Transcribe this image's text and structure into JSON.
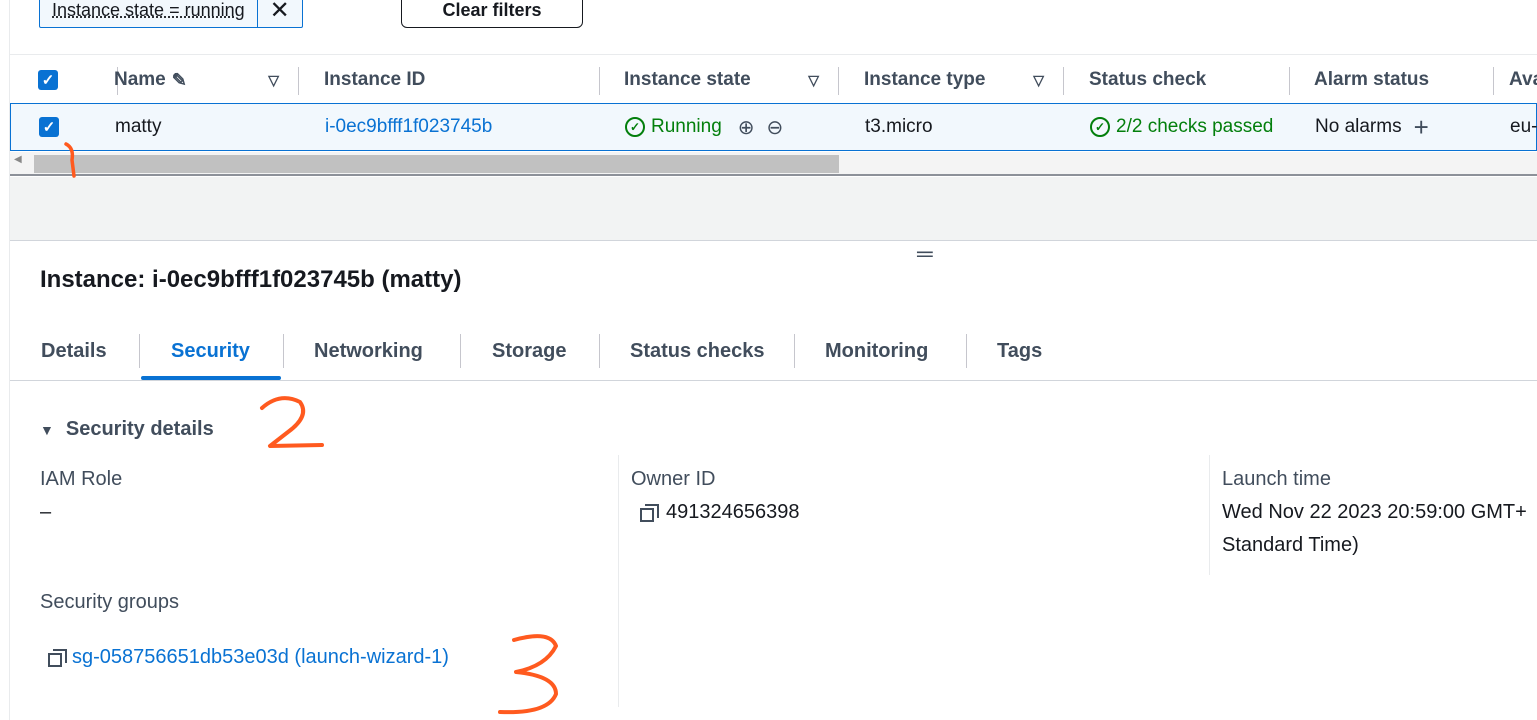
{
  "filters": {
    "token_text": "Instance state = running",
    "remove_icon": "close-icon",
    "clear_label": "Clear filters"
  },
  "table": {
    "headers": [
      "Name",
      "Instance ID",
      "Instance state",
      "Instance type",
      "Status check",
      "Alarm status",
      "Ava"
    ],
    "row": {
      "name": "matty",
      "instance_id": "i-0ec9bfff1f023745b",
      "state": "Running",
      "type": "t3.micro",
      "status_check": "2/2 checks passed",
      "alarm": "No alarms",
      "az": "eu-"
    }
  },
  "panel": {
    "title": "Instance: i-0ec9bfff1f023745b (matty)",
    "tabs": [
      "Details",
      "Security",
      "Networking",
      "Storage",
      "Status checks",
      "Monitoring",
      "Tags"
    ],
    "active_tab": "Security",
    "section_title": "Security details",
    "iam_role": {
      "label": "IAM Role",
      "value": "–"
    },
    "owner_id": {
      "label": "Owner ID",
      "value": "491324656398"
    },
    "launch_time": {
      "label": "Launch time",
      "line1": "Wed Nov 22 2023 20:59:00 GMT+",
      "line2": "Standard Time)"
    },
    "security_groups": {
      "label": "Security groups",
      "value": "sg-058756651db53e03d (launch-wizard-1)"
    }
  },
  "annotations": [
    "1",
    "2",
    "3"
  ],
  "colors": {
    "accent": "#0972d3",
    "success": "#037f0c",
    "annotation": "#ff5a1f"
  }
}
